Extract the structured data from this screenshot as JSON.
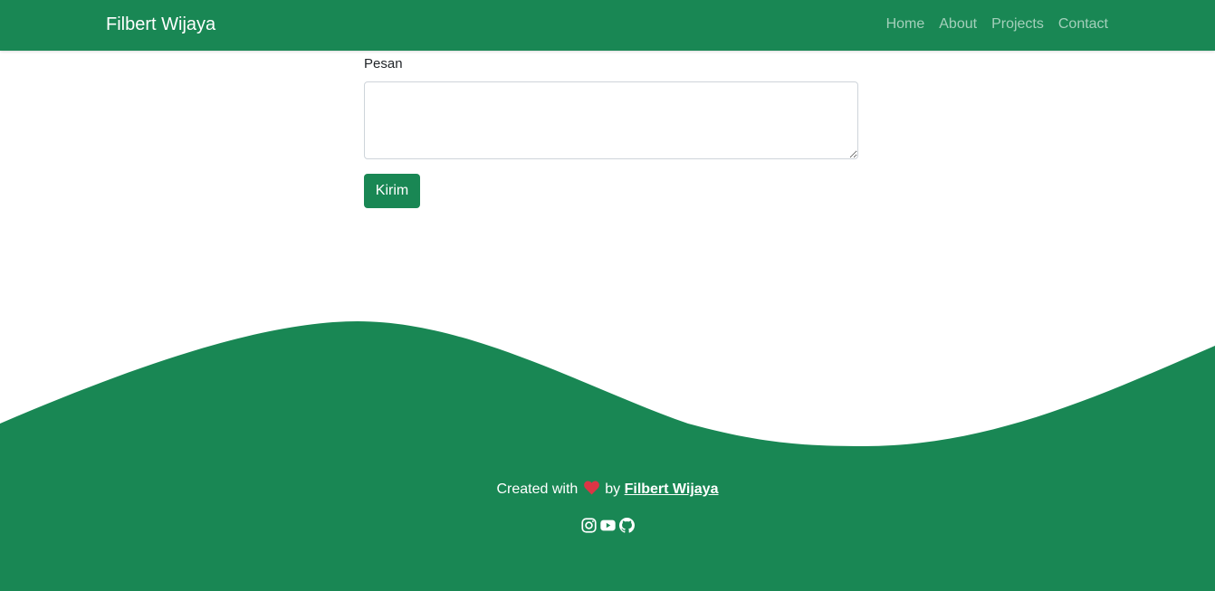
{
  "navbar": {
    "brand": "Filbert Wijaya",
    "links": [
      "Home",
      "About",
      "Projects",
      "Contact"
    ]
  },
  "form": {
    "message_label": "Pesan",
    "message_value": "",
    "submit_label": "Kirim"
  },
  "footer": {
    "created_with": "Created with",
    "by": "by",
    "author": "Filbert Wijaya",
    "social_icons": [
      "instagram-icon",
      "youtube-icon",
      "github-icon"
    ]
  },
  "colors": {
    "primary": "#198754",
    "heart": "#dc3545"
  }
}
